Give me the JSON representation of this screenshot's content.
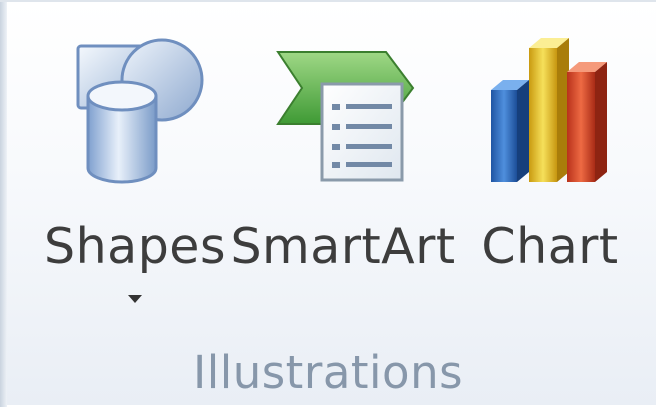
{
  "ribbon_group": {
    "label": "Illustrations",
    "buttons": [
      {
        "id": "shapes",
        "label": "Shapes",
        "icon": "shapes-icon",
        "has_dropdown": true
      },
      {
        "id": "smartart",
        "label": "SmartArt",
        "icon": "smartart-icon",
        "has_dropdown": false
      },
      {
        "id": "chart",
        "label": "Chart",
        "icon": "bar-chart-icon",
        "has_dropdown": false
      }
    ]
  },
  "colors": {
    "label_text": "#3d3d3d",
    "group_label_text": "#8797aa",
    "smartart_green": "#5aa84a",
    "chart_blue": "#2a67b6",
    "chart_yellow": "#e8c323",
    "chart_red": "#d64a2c"
  }
}
